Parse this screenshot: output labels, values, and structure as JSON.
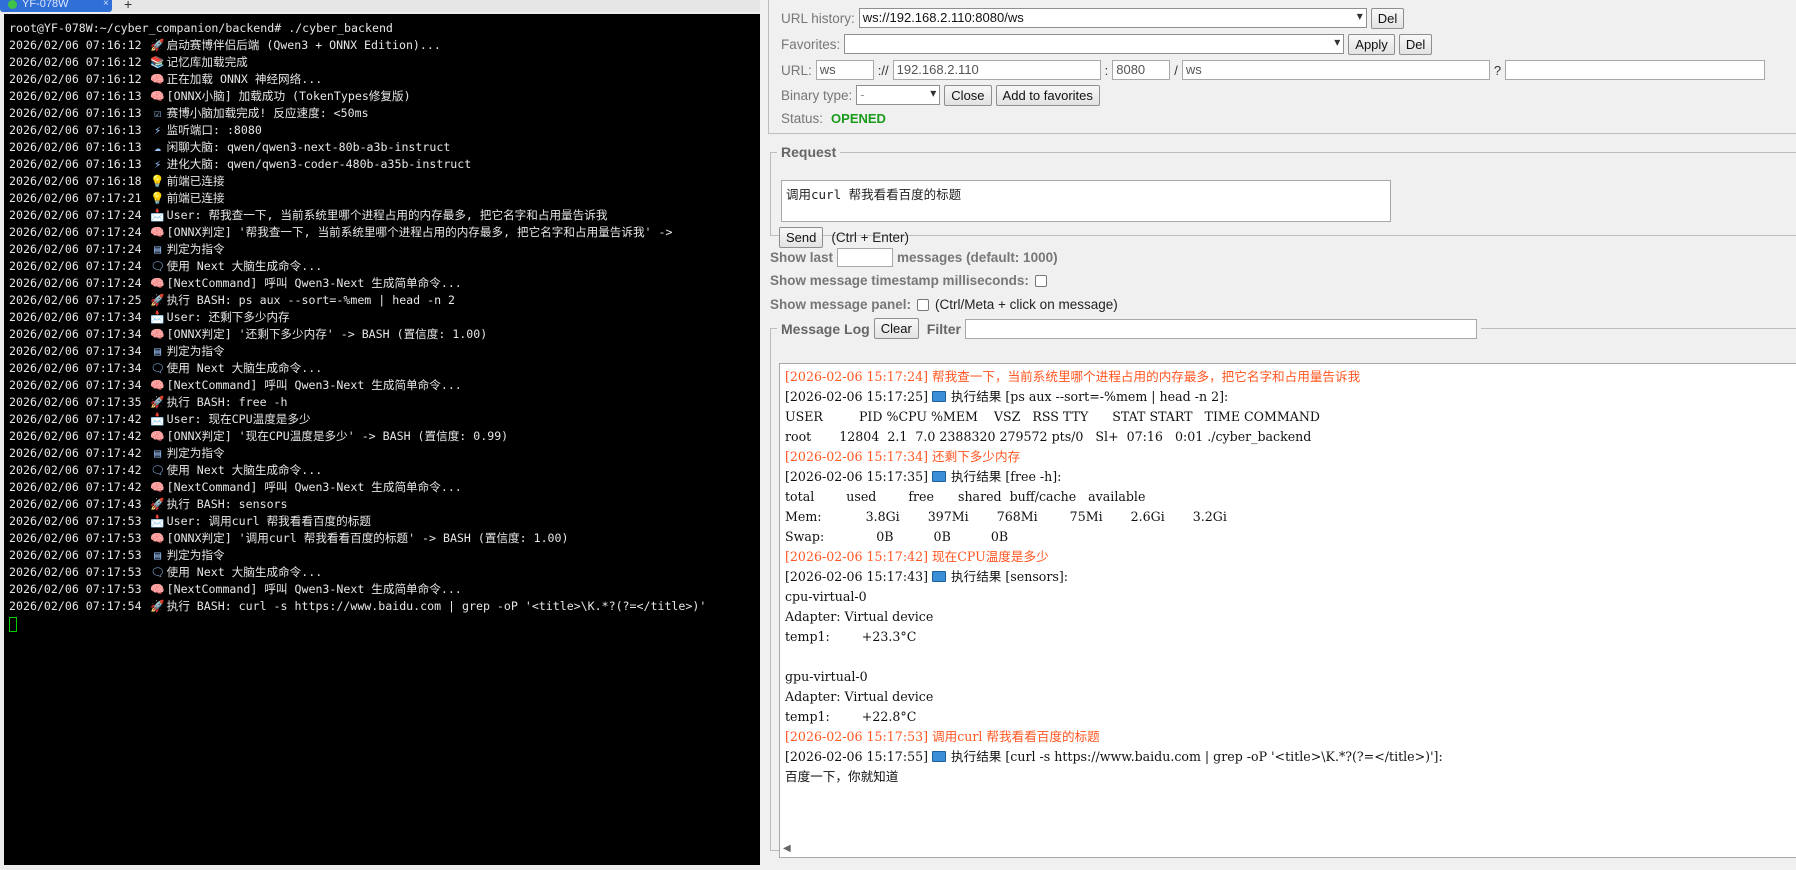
{
  "terminal": {
    "tab_title": "YF-078W",
    "tab_close": "×",
    "new_tab": "+",
    "lines": [
      {
        "icon": "",
        "text": "root@YF-078W:~/cyber_companion/backend# ./cyber_backend"
      },
      {
        "icon": "🚀",
        "text": "2026/02/06 07:16:12 ",
        "rest": "启动赛博伴侣后端 (Qwen3 + ONNX Edition)..."
      },
      {
        "icon": "📚",
        "text": "2026/02/06 07:16:12 ",
        "rest": "记忆库加载完成"
      },
      {
        "icon": "🧠",
        "text": "2026/02/06 07:16:12 ",
        "rest": "正在加载 ONNX 神经网络..."
      },
      {
        "icon": "🧠",
        "text": "2026/02/06 07:16:13 ",
        "rest": "[ONNX小脑] 加载成功 (TokenTypes修复版)"
      },
      {
        "icon": "☑",
        "text": "2026/02/06 07:16:13 ",
        "rest": "赛博小脑加载完成! 反应速度: <50ms"
      },
      {
        "icon": "⚡",
        "text": "2026/02/06 07:16:13 ",
        "rest": "监听端口: :8080"
      },
      {
        "icon": "☁",
        "text": "2026/02/06 07:16:13 ",
        "rest": "闲聊大脑: qwen/qwen3-next-80b-a3b-instruct"
      },
      {
        "icon": "⚡",
        "text": "2026/02/06 07:16:13 ",
        "rest": "进化大脑: qwen/qwen3-coder-480b-a35b-instruct"
      },
      {
        "icon": "💡",
        "text": "2026/02/06 07:16:18 ",
        "rest": "前端已连接"
      },
      {
        "icon": "💡",
        "text": "2026/02/06 07:17:21 ",
        "rest": "前端已连接"
      },
      {
        "icon": "📩",
        "text": "2026/02/06 07:17:24 ",
        "rest": "User: 帮我查一下, 当前系统里哪个进程占用的内存最多, 把它名字和占用量告诉我"
      },
      {
        "icon": "🧠",
        "text": "2026/02/06 07:17:24 ",
        "rest": "[ONNX判定] '帮我查一下, 当前系统里哪个进程占用的内存最多, 把它名字和占用量告诉我' ->"
      },
      {
        "icon": "▤",
        "text": "2026/02/06 07:17:24 ",
        "rest": "判定为指令"
      },
      {
        "icon": "🗨",
        "text": "2026/02/06 07:17:24 ",
        "rest": "使用 Next 大脑生成命令..."
      },
      {
        "icon": "🧠",
        "text": "2026/02/06 07:17:24 ",
        "rest": "[NextCommand] 呼叫 Qwen3-Next 生成简单命令..."
      },
      {
        "icon": "🚀",
        "text": "2026/02/06 07:17:25 ",
        "rest": "执行 BASH: ps aux --sort=-%mem | head -n 2"
      },
      {
        "icon": "📩",
        "text": "2026/02/06 07:17:34 ",
        "rest": "User: 还剩下多少内存"
      },
      {
        "icon": "🧠",
        "text": "2026/02/06 07:17:34 ",
        "rest": "[ONNX判定] '还剩下多少内存' -> BASH (置信度: 1.00)"
      },
      {
        "icon": "▤",
        "text": "2026/02/06 07:17:34 ",
        "rest": "判定为指令"
      },
      {
        "icon": "🗨",
        "text": "2026/02/06 07:17:34 ",
        "rest": "使用 Next 大脑生成命令..."
      },
      {
        "icon": "🧠",
        "text": "2026/02/06 07:17:34 ",
        "rest": "[NextCommand] 呼叫 Qwen3-Next 生成简单命令..."
      },
      {
        "icon": "🚀",
        "text": "2026/02/06 07:17:35 ",
        "rest": "执行 BASH: free -h"
      },
      {
        "icon": "📩",
        "text": "2026/02/06 07:17:42 ",
        "rest": "User: 现在CPU温度是多少"
      },
      {
        "icon": "🧠",
        "text": "2026/02/06 07:17:42 ",
        "rest": "[ONNX判定] '现在CPU温度是多少' -> BASH (置信度: 0.99)"
      },
      {
        "icon": "▤",
        "text": "2026/02/06 07:17:42 ",
        "rest": "判定为指令"
      },
      {
        "icon": "🗨",
        "text": "2026/02/06 07:17:42 ",
        "rest": "使用 Next 大脑生成命令..."
      },
      {
        "icon": "🧠",
        "text": "2026/02/06 07:17:42 ",
        "rest": "[NextCommand] 呼叫 Qwen3-Next 生成简单命令..."
      },
      {
        "icon": "🚀",
        "text": "2026/02/06 07:17:43 ",
        "rest": "执行 BASH: sensors"
      },
      {
        "icon": "📩",
        "text": "2026/02/06 07:17:53 ",
        "rest": "User: 调用curl 帮我看看百度的标题"
      },
      {
        "icon": "🧠",
        "text": "2026/02/06 07:17:53 ",
        "rest": "[ONNX判定] '调用curl 帮我看看百度的标题' -> BASH (置信度: 1.00)"
      },
      {
        "icon": "▤",
        "text": "2026/02/06 07:17:53 ",
        "rest": "判定为指令"
      },
      {
        "icon": "🗨",
        "text": "2026/02/06 07:17:53 ",
        "rest": "使用 Next 大脑生成命令..."
      },
      {
        "icon": "🧠",
        "text": "2026/02/06 07:17:53 ",
        "rest": "[NextCommand] 呼叫 Qwen3-Next 生成简单命令..."
      },
      {
        "icon": "🚀",
        "text": "2026/02/06 07:17:54 ",
        "rest": "执行 BASH: curl -s https://www.baidu.com | grep -oP '<title>\\K.*?(?=</title>)'"
      }
    ]
  },
  "ws": {
    "url_history_label": "URL history:",
    "url_history_value": "ws://192.168.2.110:8080/ws",
    "del_label": "Del",
    "favorites_label": "Favorites:",
    "favorites_value": "",
    "apply_label": "Apply",
    "url_label": "URL:",
    "url_scheme": "ws",
    "url_sep1": "://",
    "url_host": "192.168.2.110",
    "url_sep2": ":",
    "url_port": "8080",
    "url_sep3": "/",
    "url_path": "ws",
    "url_sep4": "?",
    "url_query": "",
    "binary_label": "Binary type:",
    "binary_value": "-",
    "close_label": "Close",
    "add_fav_label": "Add to favorites",
    "status_label": "Status:",
    "status_value": "OPENED",
    "status_color": "#1a9a1a"
  },
  "request": {
    "legend": "Request",
    "text": "调用curl 帮我看看百度的标题",
    "send_label": "Send",
    "hint": "(Ctrl + Enter)"
  },
  "options": {
    "show_last_label": "Show last",
    "show_last_value": "",
    "show_last_suffix": "messages (default: 1000)",
    "timestamp_ms_label": "Show message timestamp milliseconds:",
    "panel_label": "Show message panel:",
    "panel_hint": "(Ctrl/Meta + click on message)"
  },
  "log": {
    "legend": "Message Log",
    "clear_label": "Clear",
    "filter_label": "Filter",
    "filter_value": "",
    "sent_color": "#ff5722",
    "lines": [
      {
        "type": "sent",
        "text": "[2026-02-06 15:17:24] 帮我查一下，当前系统里哪个进程占用的内存最多，把它名字和占用量告诉我"
      },
      {
        "type": "recv",
        "icon": true,
        "pre": "[2026-02-06 15:17:25]",
        "text": "执行结果 [ps aux --sort=-%mem | head -n 2]:"
      },
      {
        "type": "recv",
        "text": "USER         PID %CPU %MEM    VSZ   RSS TTY      STAT START   TIME COMMAND"
      },
      {
        "type": "recv",
        "text": "root       12804  2.1  7.0 2388320 279572 pts/0   Sl+  07:16   0:01 ./cyber_backend"
      },
      {
        "type": "sent",
        "text": "[2026-02-06 15:17:34] 还剩下多少内存"
      },
      {
        "type": "recv",
        "icon": true,
        "pre": "[2026-02-06 15:17:35]",
        "text": "执行结果 [free -h]:"
      },
      {
        "type": "recv",
        "text": "total        used        free      shared  buff/cache   available"
      },
      {
        "type": "recv",
        "text": "Mem:           3.8Gi       397Mi       768Mi        75Mi       2.6Gi       3.2Gi"
      },
      {
        "type": "recv",
        "text": "Swap:             0B          0B          0B"
      },
      {
        "type": "sent",
        "text": "[2026-02-06 15:17:42] 现在CPU温度是多少"
      },
      {
        "type": "recv",
        "icon": true,
        "pre": "[2026-02-06 15:17:43]",
        "text": "执行结果 [sensors]:"
      },
      {
        "type": "recv",
        "text": "cpu-virtual-0"
      },
      {
        "type": "recv",
        "text": "Adapter: Virtual device"
      },
      {
        "type": "recv",
        "text": "temp1:        +23.3°C"
      },
      {
        "type": "recv",
        "text": ""
      },
      {
        "type": "recv",
        "text": "gpu-virtual-0"
      },
      {
        "type": "recv",
        "text": "Adapter: Virtual device"
      },
      {
        "type": "recv",
        "text": "temp1:        +22.8°C"
      },
      {
        "type": "sent",
        "text": "[2026-02-06 15:17:53] 调用curl 帮我看看百度的标题"
      },
      {
        "type": "recv",
        "icon": true,
        "pre": "[2026-02-06 15:17:55]",
        "text": "执行结果 [curl -s https://www.baidu.com | grep -oP '<title>\\K.*?(?=</title>)']:"
      },
      {
        "type": "recv",
        "text": "百度一下，你就知道"
      }
    ]
  }
}
